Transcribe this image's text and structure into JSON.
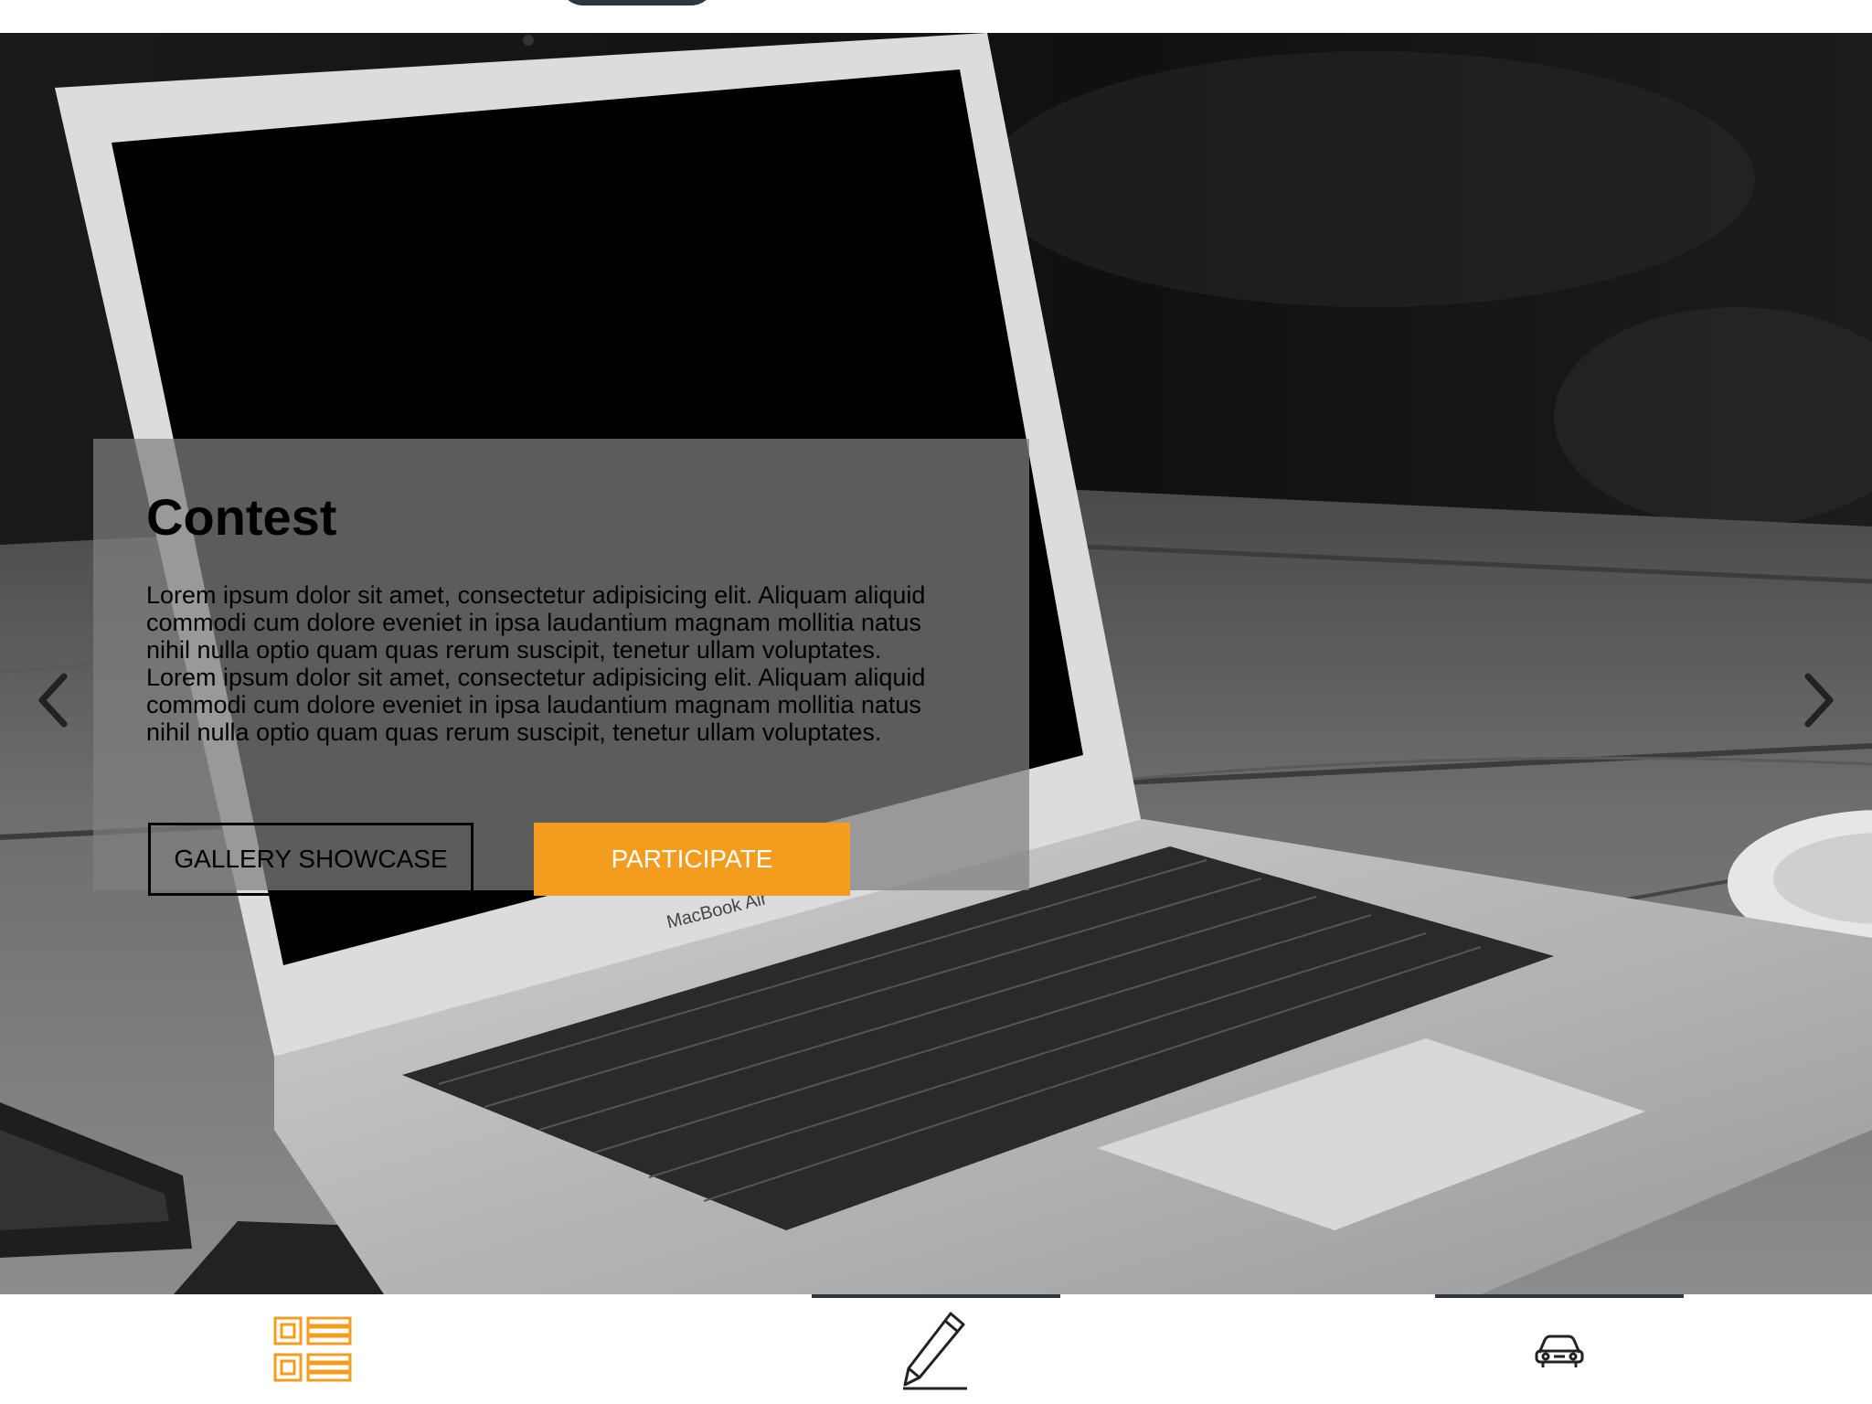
{
  "header": {
    "logo_icon": "logo-icon",
    "logo_color": "#2b3640"
  },
  "hero": {
    "background_image": "laptop-on-wooden-desk-photo",
    "prev_icon": "chevron-left-icon",
    "next_icon": "chevron-right-icon",
    "caption": {
      "title": "Contest",
      "paragraphs": [
        "Lorem ipsum dolor sit amet, consectetur adipisicing elit. Aliquam aliquid commodi cum dolore eveniet in ipsa laudantium magnam mollitia natus nihil nulla optio quam quas rerum suscipit, tenetur ullam voluptates.",
        "Lorem ipsum dolor sit amet, consectetur adipisicing elit. Aliquam aliquid commodi cum dolore eveniet in ipsa laudantium magnam mollitia natus nihil nulla optio quam quas rerum suscipit, tenetur ullam voluptates."
      ],
      "buttons": {
        "gallery_label": "GALLERY SHOWCASE",
        "participate_label": "PARTICIPATE"
      }
    },
    "laptop_brand_text": "MacBook Air"
  },
  "bottom_nav": {
    "items": [
      {
        "icon": "list-icon",
        "active": true
      },
      {
        "icon": "pencil-icon",
        "active": false
      },
      {
        "icon": "car-icon",
        "active": false
      }
    ]
  },
  "colors": {
    "accent": "#f39c1e",
    "caption_overlay": "rgba(128,128,128,0.72)",
    "nav_indicator": "#2b3640"
  }
}
